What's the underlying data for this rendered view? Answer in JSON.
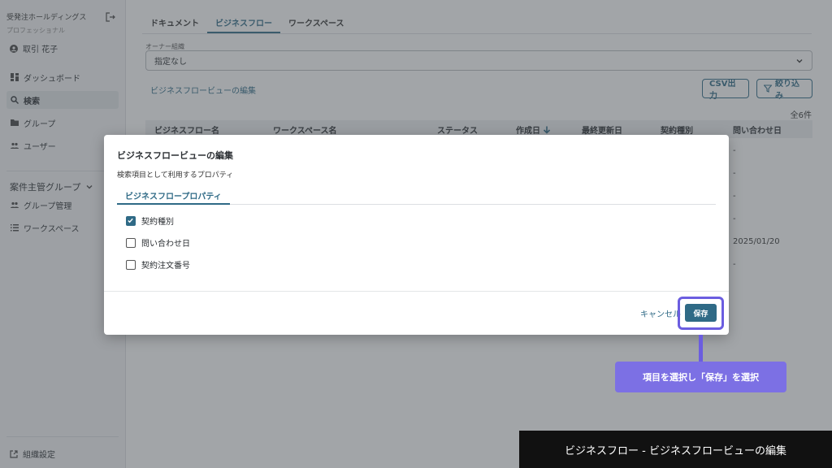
{
  "sidebar": {
    "org_name": "受発注ホールディングス",
    "org_plan": "プロフェッショナル",
    "user_name": "取引 花子",
    "items": [
      {
        "label": "ダッシュボード"
      },
      {
        "label": "検索"
      },
      {
        "label": "グループ"
      },
      {
        "label": "ユーザー"
      }
    ],
    "group_heading": "案件主管グループ",
    "group_items": [
      {
        "label": "グループ管理"
      },
      {
        "label": "ワークスペース"
      }
    ],
    "settings_label": "組織設定"
  },
  "main": {
    "tabs": [
      {
        "label": "ドキュメント"
      },
      {
        "label": "ビジネスフロー"
      },
      {
        "label": "ワークスペース"
      }
    ],
    "owner_label": "オーナー組織",
    "owner_value": "指定なし",
    "edit_view_link": "ビジネスフロービューの編集",
    "csv_button": "CSV出力",
    "filter_button": "絞り込み",
    "total_count": "全6件",
    "columns": [
      "ビジネスフロー名",
      "ワークスペース名",
      "ステータス",
      "作成日",
      "最終更新日",
      "契約種別",
      "問い合わせ日"
    ],
    "inquiry_date_cells": [
      "-",
      "-",
      "-",
      "-",
      "2025/01/20",
      "-"
    ]
  },
  "modal": {
    "title": "ビジネスフロービューの編集",
    "subtitle": "検索項目として利用するプロパティ",
    "tab_label": "ビジネスフロープロパティ",
    "options": [
      {
        "label": "契約種別",
        "checked": true
      },
      {
        "label": "問い合わせ日",
        "checked": false
      },
      {
        "label": "契約注文番号",
        "checked": false
      }
    ],
    "cancel_label": "キャンセル",
    "save_label": "保存"
  },
  "callout": {
    "text": "項目を選択し「保存」を選択"
  },
  "caption": {
    "text": "ビジネスフロー - ビジネスフロービューの編集"
  },
  "colors": {
    "accent": "#2f6a86",
    "highlight": "#6b5de0",
    "callout": "#7c70e4"
  }
}
